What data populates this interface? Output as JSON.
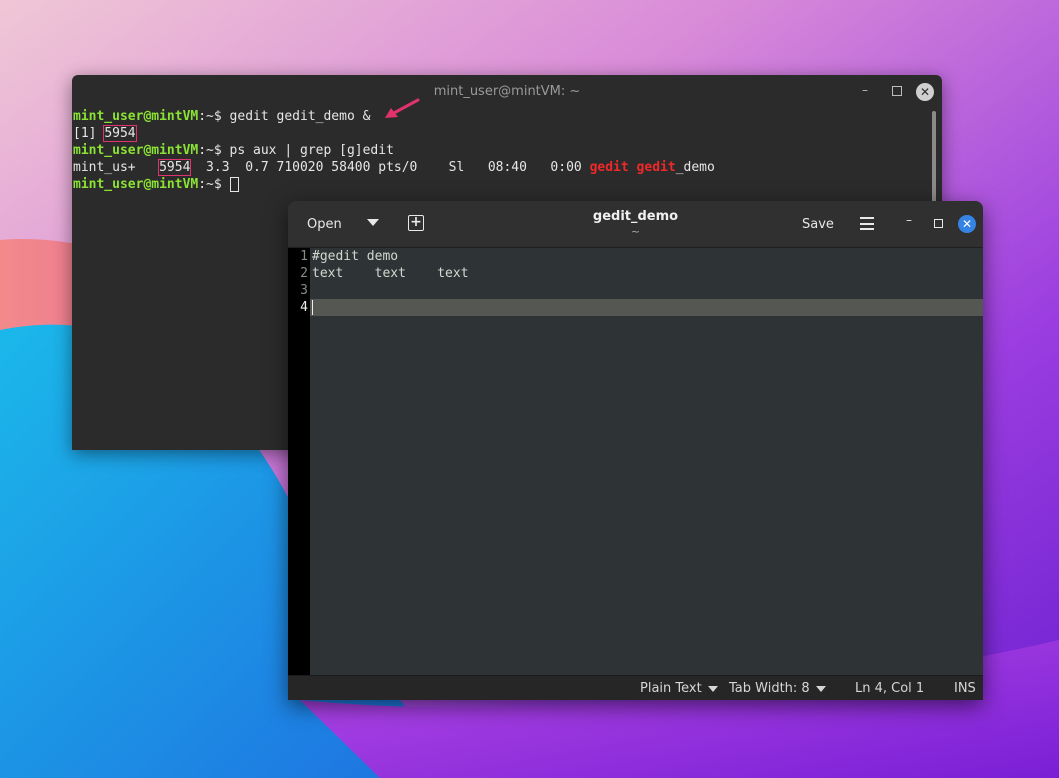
{
  "terminal": {
    "title": "mint_user@mintVM: ~",
    "controls": {
      "minimize": "–",
      "close": "✕"
    },
    "lines": [
      {
        "prompt_user": "mint_user@mintVM",
        "prompt_rest": ":~$ ",
        "command": "gedit gedit_demo &"
      },
      {
        "job": "[1] ",
        "pid": "5954"
      },
      {
        "prompt_user": "mint_user@mintVM",
        "prompt_rest": ":~$ ",
        "command": "ps aux | grep [g]edit"
      },
      {
        "user": "mint_us+   ",
        "pid": "5954",
        "stats": "  3.3  0.7 710020 58400 pts/0    Sl   08:40   0:00 ",
        "match1": "gedit",
        "space": " ",
        "match2": "gedit",
        "rest": "_demo"
      },
      {
        "prompt_user": "mint_user@mintVM",
        "prompt_rest": ":~$ "
      }
    ],
    "annotation_color": "#e0336b"
  },
  "gedit": {
    "open_label": "Open",
    "save_label": "Save",
    "new_tab_symbol": "+",
    "title": "gedit_demo",
    "subtitle": "~",
    "close_symbol": "✕",
    "minimize_symbol": "–",
    "line_numbers": [
      "1",
      "2",
      "3",
      "4"
    ],
    "lines": [
      "#gedit demo",
      "text    text    text",
      "",
      ""
    ],
    "status": {
      "language": "Plain Text",
      "tab_width": "Tab Width: 8",
      "position": "Ln 4, Col 1",
      "mode": "INS"
    },
    "accent": "#3584e4"
  }
}
